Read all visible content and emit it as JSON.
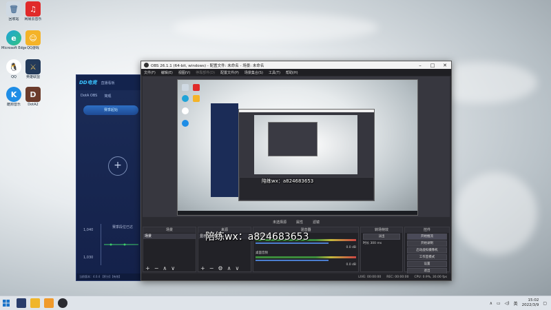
{
  "desktop_icons": [
    {
      "label": "回收站"
    },
    {
      "label": "网易云音乐"
    },
    {
      "label": "Microsoft Edge"
    },
    {
      "label": "QQ游戏"
    },
    {
      "label": "QQ"
    },
    {
      "label": "英雄联盟"
    },
    {
      "label": "酷狗音乐"
    },
    {
      "label": "DotA2"
    }
  ],
  "background_app": {
    "logo": "DD电竞",
    "nav_item": "直播看板",
    "tab1": "DotA OBS",
    "tab2": "简观",
    "season_button": "赛季起始",
    "chart_title": "赛季段位已达",
    "y_high": "1,040",
    "y_low": "1,030",
    "footer": "当前版本：4.0.4  【积分】【有效】"
  },
  "obs": {
    "title": "OBS 26.1.1 (64-bit, windows) - 配置文件: 未命名 - 场景: 未命名",
    "menu": [
      "文件(F)",
      "编辑(E)",
      "视图(V)",
      "停靠部件(D)",
      "配置文件(P)",
      "场景集合(S)",
      "工具(T)",
      "帮助(H)"
    ],
    "dock_toolbar": [
      "属性",
      "滤镜"
    ],
    "panels": {
      "scenes": {
        "title": "场景",
        "item": "场景"
      },
      "sources": {
        "title": "来源",
        "item": "显示器采集"
      },
      "mixer": {
        "title": "混音器",
        "ch1": "桌面音频",
        "ch1_db": "0.0 dB",
        "ch2": "麦克风/Aux",
        "ch2_db": "0.0 dB"
      },
      "transitions": {
        "title": "转场特效",
        "type": "淡出",
        "duration_label": "时长",
        "duration": "300 ms"
      },
      "controls": {
        "title": "控件",
        "buttons": [
          "开始推流",
          "开始录制",
          "启动虚拟摄像机",
          "工作室模式",
          "设置",
          "退出"
        ]
      }
    },
    "status": {
      "live": "LIVE: 00:00:00",
      "rec": "REC: 00:00:00",
      "cpu": "CPU: 0.9%, 30.00 fps"
    },
    "no_source": "未选择源"
  },
  "overlay": {
    "big": "陪练wx：a824683653",
    "small": "陪练wx：a824683653"
  },
  "taskbar": {
    "time": "15:02",
    "date": "2022/3/9",
    "lang": "英"
  },
  "colors": {
    "obs_bg": "#2b2b31",
    "accent": "#4c7fd1",
    "bgapp": "#1b2c57"
  }
}
